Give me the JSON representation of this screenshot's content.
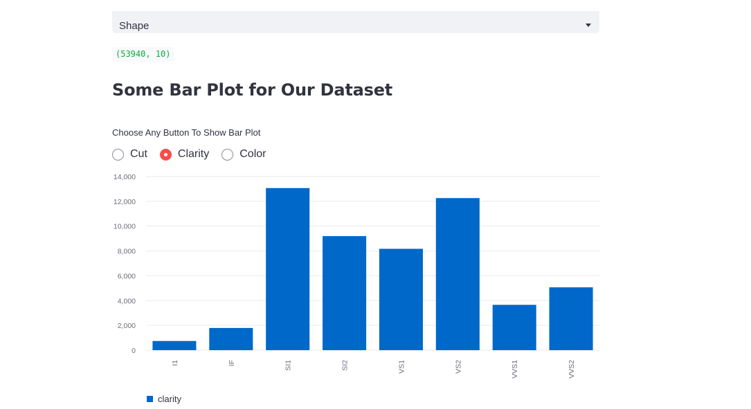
{
  "select": {
    "value": "Shape"
  },
  "output": {
    "text": "(53940, 10)"
  },
  "heading": "Some Bar Plot for Our Dataset",
  "radio": {
    "label": "Choose Any Button To Show Bar Plot",
    "options": [
      "Cut",
      "Clarity",
      "Color"
    ],
    "selected": "Clarity"
  },
  "colors": {
    "bar": "#0068c9",
    "accent": "#ff4b4b",
    "code": "#09ab3b"
  },
  "chart_data": {
    "type": "bar",
    "categories": [
      "I1",
      "IF",
      "SI1",
      "SI2",
      "VS1",
      "VS2",
      "VVS1",
      "VVS2"
    ],
    "series": [
      {
        "name": "clarity",
        "values": [
          741,
          1790,
          13065,
          9194,
          8171,
          12258,
          3655,
          5066
        ]
      }
    ],
    "ylim": [
      0,
      14000
    ],
    "yticks": [
      0,
      2000,
      4000,
      6000,
      8000,
      10000,
      12000,
      14000
    ],
    "ytick_labels": [
      "0",
      "2,000",
      "4,000",
      "6,000",
      "8,000",
      "10,000",
      "12,000",
      "14,000"
    ],
    "grid": true,
    "legend": "bottom-left"
  }
}
